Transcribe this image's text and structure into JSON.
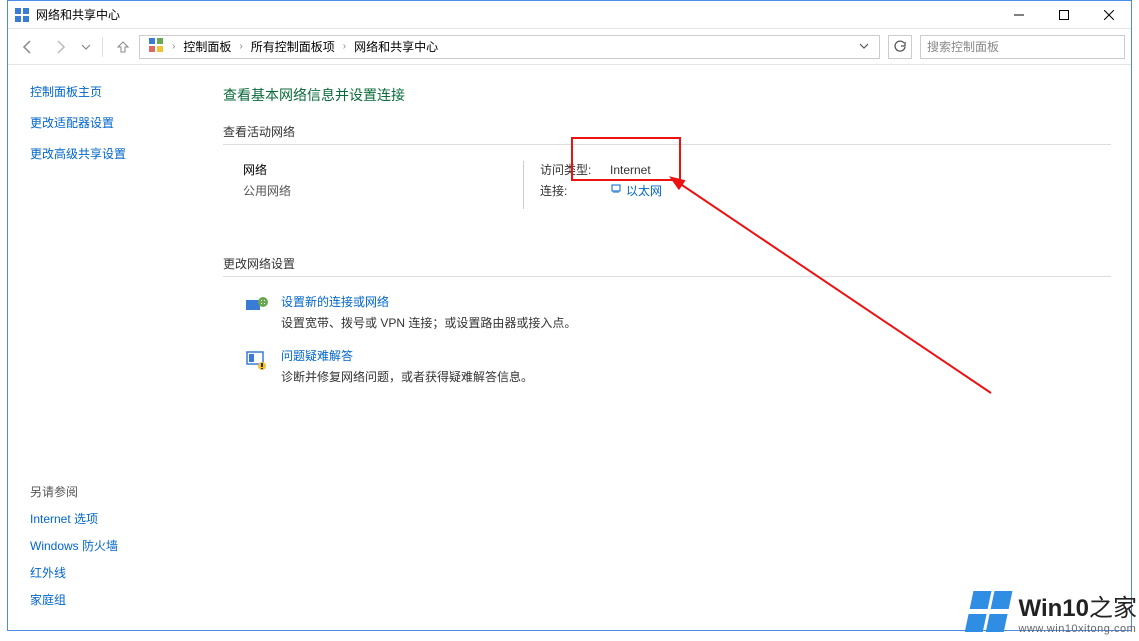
{
  "titlebar": {
    "title": "网络和共享中心"
  },
  "breadcrumbs": {
    "items": [
      "控制面板",
      "所有控制面板项",
      "网络和共享中心"
    ]
  },
  "search": {
    "placeholder": "搜索控制面板"
  },
  "sidebar": {
    "home": "控制面板主页",
    "links": [
      "更改适配器设置",
      "更改高级共享设置"
    ],
    "see_also_header": "另请参阅",
    "see_also": [
      "Internet 选项",
      "Windows 防火墙",
      "红外线",
      "家庭组"
    ]
  },
  "content": {
    "heading": "查看基本网络信息并设置连接",
    "active_header": "查看活动网络",
    "network": {
      "name": "网络",
      "type": "公用网络",
      "access_label": "访问类型:",
      "access_value": "Internet",
      "conn_label": "连接:",
      "conn_value": "以太网"
    },
    "change_header": "更改网络设置",
    "options": [
      {
        "title": "设置新的连接或网络",
        "desc": "设置宽带、拨号或 VPN 连接；或设置路由器或接入点。"
      },
      {
        "title": "问题疑难解答",
        "desc": "诊断并修复网络问题，或者获得疑难解答信息。"
      }
    ]
  },
  "watermark": {
    "brand_prefix": "Win10",
    "brand_suffix": "之家",
    "url": "www.win10xitong.com"
  }
}
